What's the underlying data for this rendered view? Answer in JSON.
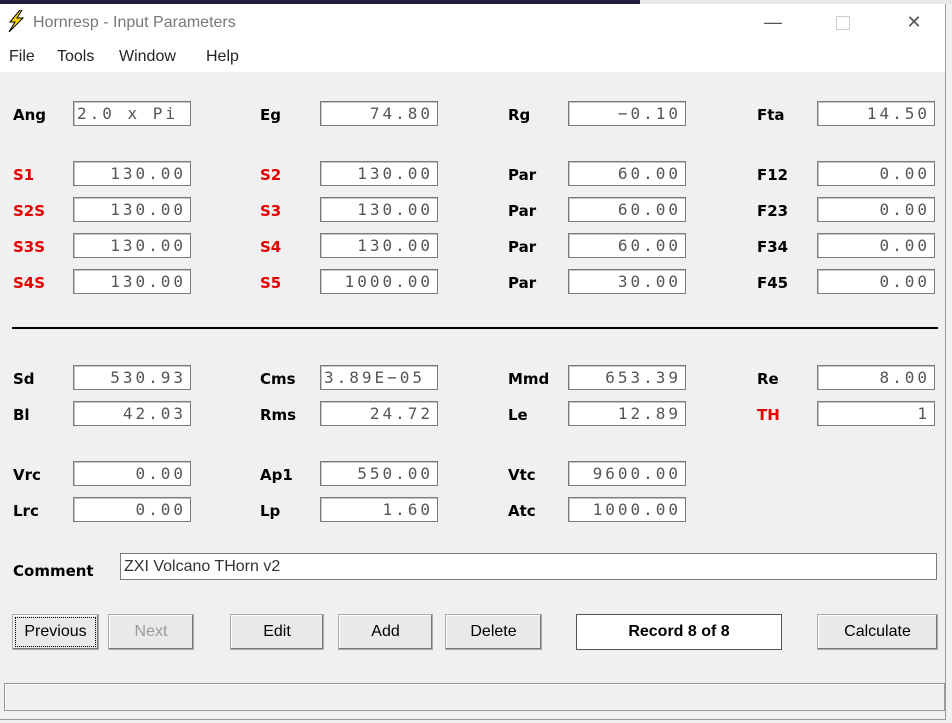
{
  "window": {
    "title": "Hornresp - Input Parameters",
    "minimize": "—",
    "close": "✕"
  },
  "menu": [
    "File",
    "Tools",
    "Window",
    "Help"
  ],
  "params": {
    "Ang": {
      "label": "Ang",
      "value": "2.0 x Pi"
    },
    "Eg": {
      "label": "Eg",
      "value": "74.80"
    },
    "Rg": {
      "label": "Rg",
      "value": "−0.10"
    },
    "Fta": {
      "label": "Fta",
      "value": "14.50"
    },
    "S1": {
      "label": "S1",
      "value": "130.00"
    },
    "S2": {
      "label": "S2",
      "value": "130.00"
    },
    "Par1": {
      "label": "Par",
      "value": "60.00"
    },
    "F12": {
      "label": "F12",
      "value": "0.00"
    },
    "S2S": {
      "label": "S2S",
      "value": "130.00"
    },
    "S3": {
      "label": "S3",
      "value": "130.00"
    },
    "Par2": {
      "label": "Par",
      "value": "60.00"
    },
    "F23": {
      "label": "F23",
      "value": "0.00"
    },
    "S3S": {
      "label": "S3S",
      "value": "130.00"
    },
    "S4": {
      "label": "S4",
      "value": "130.00"
    },
    "Par3": {
      "label": "Par",
      "value": "60.00"
    },
    "F34": {
      "label": "F34",
      "value": "0.00"
    },
    "S4S": {
      "label": "S4S",
      "value": "130.00"
    },
    "S5": {
      "label": "S5",
      "value": "1000.00"
    },
    "Par4": {
      "label": "Par",
      "value": "30.00"
    },
    "F45": {
      "label": "F45",
      "value": "0.00"
    },
    "Sd": {
      "label": "Sd",
      "value": "530.93"
    },
    "Cms": {
      "label": "Cms",
      "value": "3.89E−05"
    },
    "Mmd": {
      "label": "Mmd",
      "value": "653.39"
    },
    "Re": {
      "label": "Re",
      "value": "8.00"
    },
    "Bl": {
      "label": "Bl",
      "value": "42.03"
    },
    "Rms": {
      "label": "Rms",
      "value": "24.72"
    },
    "Le": {
      "label": "Le",
      "value": "12.89"
    },
    "TH": {
      "label": "TH",
      "value": "1"
    },
    "Vrc": {
      "label": "Vrc",
      "value": "0.00"
    },
    "Ap1": {
      "label": "Ap1",
      "value": "550.00"
    },
    "Vtc": {
      "label": "Vtc",
      "value": "9600.00"
    },
    "Lrc": {
      "label": "Lrc",
      "value": "0.00"
    },
    "Lp": {
      "label": "Lp",
      "value": "1.60"
    },
    "Atc": {
      "label": "Atc",
      "value": "1000.00"
    }
  },
  "comment": {
    "label": "Comment",
    "value": "ZXI Volcano THorn v2"
  },
  "buttons": {
    "previous": "Previous",
    "next": "Next",
    "edit": "Edit",
    "add": "Add",
    "delete": "Delete",
    "calculate": "Calculate"
  },
  "record": "Record 8 of 8",
  "colors": {
    "red_label": "#e60000",
    "icon_yellow": "#ffd800"
  }
}
